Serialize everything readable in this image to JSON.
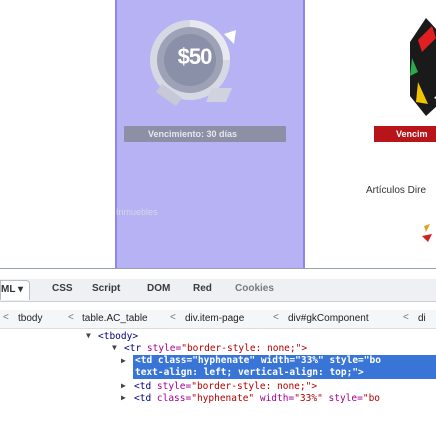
{
  "page": {
    "coin_value": "$50",
    "venc_button": "Vencimiento: 30 días",
    "venc_button_2": "Vencim",
    "inmuebles_label": "Inmuebles",
    "articulos_label": "Artículos Dire"
  },
  "devtools": {
    "tabs": [
      {
        "label": "ML ▾",
        "active": true
      },
      {
        "label": "CSS"
      },
      {
        "label": "Script"
      },
      {
        "label": "DOM"
      },
      {
        "label": "Red"
      },
      {
        "label": "Cookies"
      }
    ],
    "breadcrumbs": [
      "tbody",
      "table.AC_table",
      "div.item-page",
      "div#gkComponent",
      "di"
    ],
    "tree": {
      "line1": "<tbody>",
      "line2_tag": "<tr",
      "line2_attr": " style=",
      "line2_val": "\"border-style: none;\">",
      "sel_line1": "<td class=\"hyphenate\" width=\"33%\" style=\"bo",
      "sel_line2": "text-align: left; vertical-align: top;\">",
      "line4_tag": "<td",
      "line4_attr": " style=",
      "line4_val": "\"border-style: none;\">",
      "line5_tag": "<td",
      "line5_attr": " class=",
      "line5_val": "\"hyphenate\"",
      "line5_attr2": " width=",
      "line5_val2": "\"33%\"",
      "line5_attr3": " style=",
      "line5_val3": "\"bo"
    }
  },
  "colors": {
    "highlight_column": "#b7b2f3",
    "selection": "#3875d7",
    "red_button": "#b8151a"
  }
}
